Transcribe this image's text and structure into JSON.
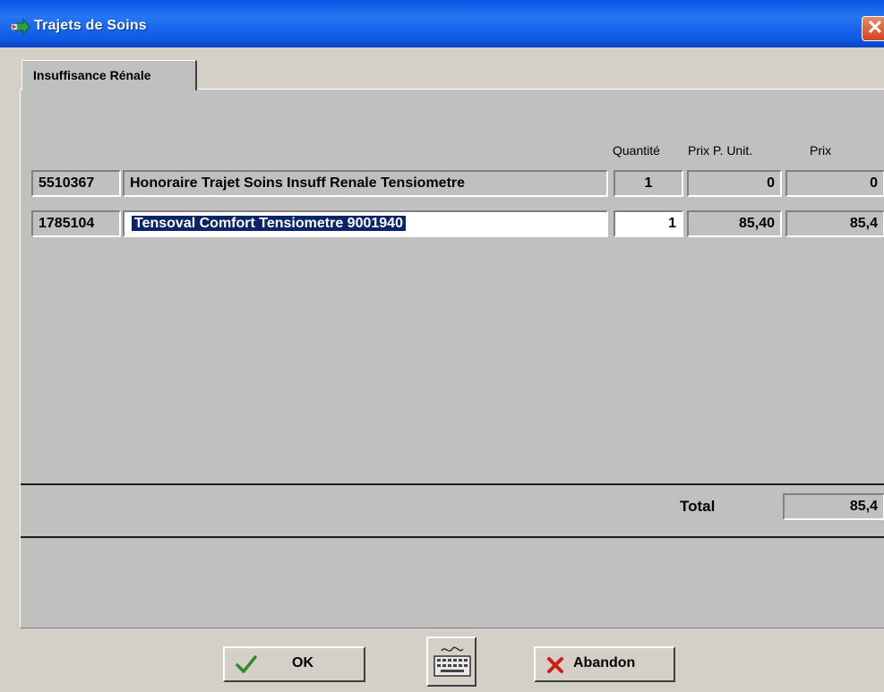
{
  "window": {
    "title": "Trajets de Soins",
    "close_label": "✕"
  },
  "tab": {
    "label": "Insuffisance Rénale"
  },
  "columns": {
    "quantite": "Quantité",
    "prix_unit": "Prix P. Unit.",
    "prix": "Prix"
  },
  "rows": [
    {
      "code": "5510367",
      "description": "Honoraire Trajet Soins Insuff Renale Tensiometre",
      "quantite": "1",
      "prix_unit": "0",
      "prix": "0"
    },
    {
      "code": "1785104",
      "description": "Tensoval Comfort Tensiometre 9001940",
      "quantite": "1",
      "prix_unit": "85,40",
      "prix": "85,4"
    }
  ],
  "total": {
    "label": "Total",
    "value": "85,4"
  },
  "buttons": {
    "ok": "OK",
    "abandon": "Abandon"
  },
  "colors": {
    "titlebar": "#0a54e3",
    "selection": "#0a246a",
    "ok_check": "#2e8b2e",
    "abandon_x": "#d11a1a"
  }
}
